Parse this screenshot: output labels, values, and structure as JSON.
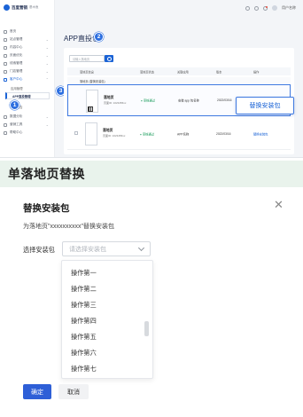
{
  "screenshot": {
    "brand": "百度营销",
    "brand_sub": "基木鱼",
    "sidebar": [
      {
        "label": "首页"
      },
      {
        "label": "站点管理"
      },
      {
        "label": "内容中心"
      },
      {
        "label": "页面优化"
      },
      {
        "label": "线索管理"
      },
      {
        "label": "门店管理"
      },
      {
        "label": "客户中心"
      }
    ],
    "sidebar_sub": [
      {
        "label": "应用管理"
      },
      {
        "label": "APP直投管理"
      },
      {
        "label": "数据报告"
      }
    ],
    "sidebar_more": [
      {
        "label": "数据分析"
      },
      {
        "label": "营销工具"
      },
      {
        "label": "帮助中心"
      }
    ],
    "user": "用户名称",
    "page_title": "APP直投包",
    "search_placeholder": "请输入落地页",
    "columns": [
      "落地页信息",
      "落地页状态",
      "关联应用",
      "版本",
      "操作"
    ],
    "group_label": "落地页 (替换安装包)",
    "rows": [
      {
        "name": "落地页",
        "meta": "页面ID: 1023456xx",
        "status": "审核通过",
        "app": "安装 app 包名称",
        "date": "2022/03/16",
        "action": ""
      },
      {
        "name": "落地页",
        "meta": "页面ID: 1023456xx",
        "status": "审核通过",
        "app": "APP名称",
        "date": "2022/03/16",
        "action": "替换安装包"
      }
    ],
    "popup_label": "替换安装包",
    "badges": [
      "1",
      "2",
      "3"
    ]
  },
  "section_heading": "单落地页替换",
  "dialog": {
    "title": "替换安装包",
    "description": "为落地页\"xxxxxxxxxx\"替换安装包",
    "field_label": "选择安装包",
    "select_placeholder": "请选择安装包",
    "options": [
      "操作第一",
      "操作第二",
      "操作第三",
      "操作第四",
      "操作第五",
      "操作第六",
      "操作第七"
    ],
    "ok_label": "确定",
    "cancel_label": "取消"
  },
  "colors": {
    "accent": "#2e5fd7",
    "band": "#e9f3ec",
    "badge": "#2d6fe0"
  }
}
